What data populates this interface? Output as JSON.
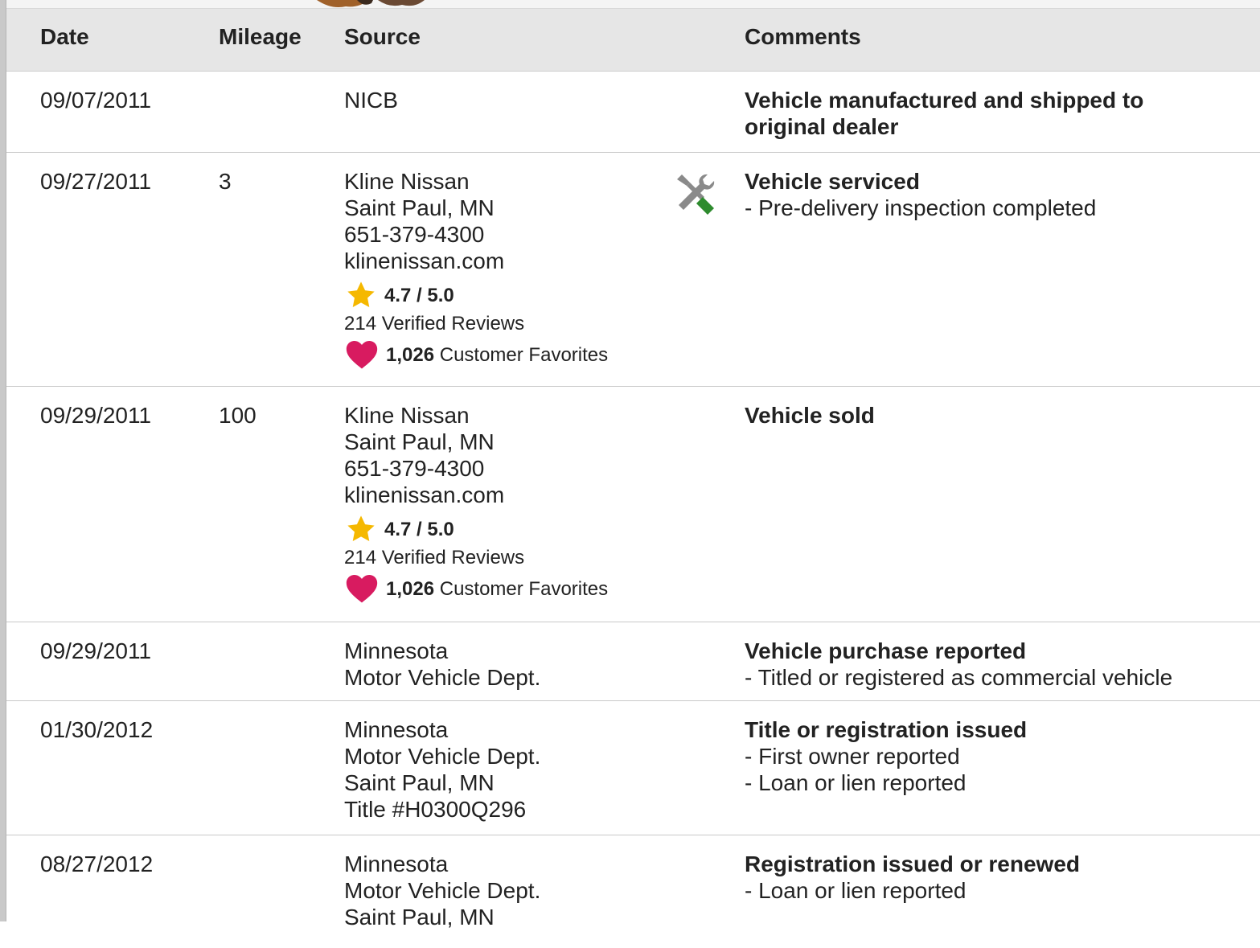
{
  "table": {
    "headers": {
      "date": "Date",
      "mileage": "Mileage",
      "source": "Source",
      "comments": "Comments"
    },
    "rows": [
      {
        "date": "09/07/2011",
        "mileage": "",
        "source": [
          "NICB"
        ],
        "comment_title": "Vehicle manufactured and shipped to original dealer",
        "comment_items": []
      },
      {
        "date": "09/27/2011",
        "mileage": "3",
        "source": [
          "Kline Nissan",
          "Saint Paul, MN",
          "651-379-4300",
          "klinenissan.com"
        ],
        "rating": {
          "value": "4.7 / 5.0",
          "reviews": "214 Verified Reviews",
          "favorites_count": "1,026",
          "favorites_label": "Customer Favorites"
        },
        "icon": "service-tools-icon",
        "comment_title": "Vehicle serviced",
        "comment_items": [
          "- Pre-delivery inspection completed"
        ]
      },
      {
        "date": "09/29/2011",
        "mileage": "100",
        "source": [
          "Kline Nissan",
          "Saint Paul, MN",
          "651-379-4300",
          "klinenissan.com"
        ],
        "rating": {
          "value": "4.7 / 5.0",
          "reviews": "214 Verified Reviews",
          "favorites_count": "1,026",
          "favorites_label": "Customer Favorites"
        },
        "comment_title": "Vehicle sold",
        "comment_items": []
      },
      {
        "date": "09/29/2011",
        "mileage": "",
        "source": [
          "Minnesota",
          "Motor Vehicle Dept."
        ],
        "comment_title": "Vehicle purchase reported",
        "comment_items": [
          "- Titled or registered as commercial vehicle"
        ]
      },
      {
        "date": "01/30/2012",
        "mileage": "",
        "source": [
          "Minnesota",
          "Motor Vehicle Dept.",
          "Saint Paul, MN",
          "Title #H0300Q296"
        ],
        "comment_title": "Title or registration issued",
        "comment_items": [
          "- First owner reported",
          "- Loan or lien reported"
        ]
      },
      {
        "date": "08/27/2012",
        "mileage": "",
        "source": [
          "Minnesota",
          "Motor Vehicle Dept.",
          "Saint Paul, MN"
        ],
        "comment_title": "Registration issued or renewed",
        "comment_items": [
          "- Loan or lien reported"
        ]
      }
    ]
  },
  "colors": {
    "header_bg": "#e6e6e6",
    "star": "#f5b800",
    "heart": "#d81b60",
    "tool_green": "#2e8b2e",
    "tool_gray": "#8a8a8a"
  }
}
